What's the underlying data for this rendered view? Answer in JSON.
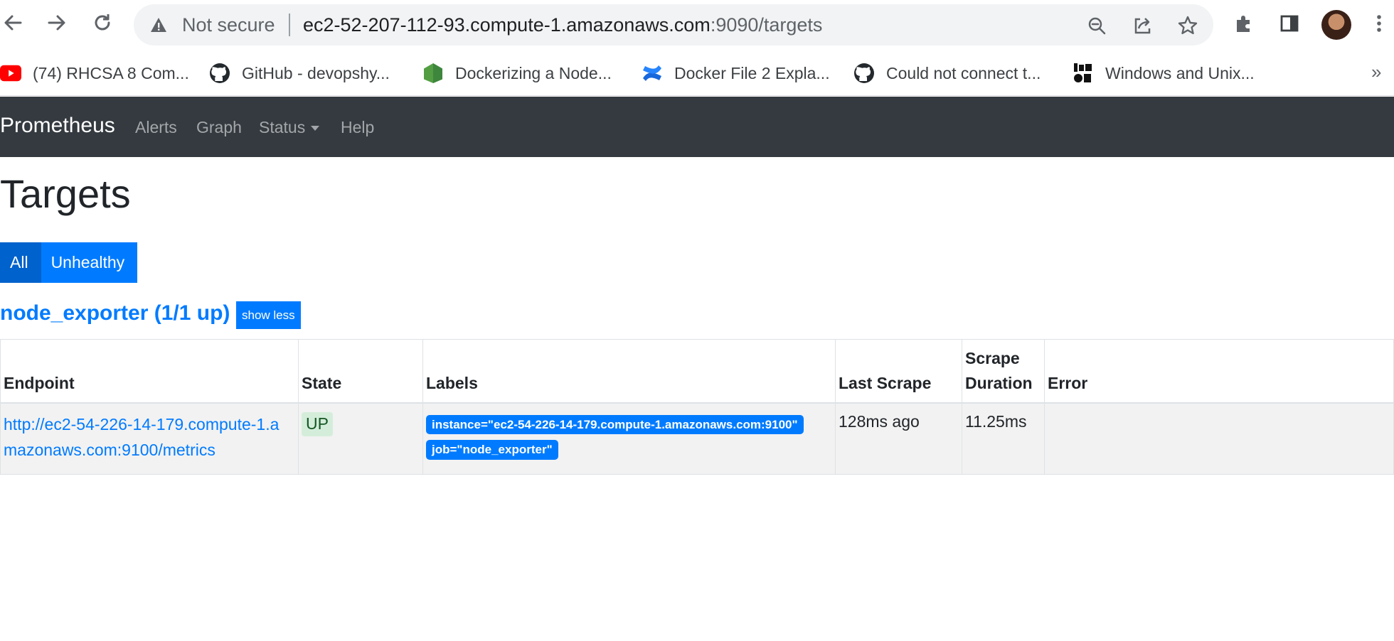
{
  "browser": {
    "security_label": "Not secure",
    "url_host": "ec2-52-207-112-93.compute-1.amazonaws.com",
    "url_rest": ":9090/targets",
    "bookmarks": [
      {
        "label": "(74) RHCSA 8 Com...",
        "icon": "youtube-icon"
      },
      {
        "label": "GitHub - devopshy...",
        "icon": "github-icon"
      },
      {
        "label": "Dockerizing a Node...",
        "icon": "nodejs-icon"
      },
      {
        "label": "Docker File 2 Expla...",
        "icon": "confluence-icon"
      },
      {
        "label": "Could not connect t...",
        "icon": "github-icon"
      },
      {
        "label": "Windows and Unix...",
        "icon": "lemoda-icon"
      }
    ],
    "more_bookmarks": "»"
  },
  "navbar": {
    "brand": "Prometheus",
    "links": [
      "Alerts",
      "Graph",
      "Status",
      "Help"
    ]
  },
  "page": {
    "title": "Targets",
    "filter_all": "All",
    "filter_unhealthy": "Unhealthy"
  },
  "job": {
    "title": "node_exporter (1/1 up)",
    "toggle": "show less",
    "columns": [
      "Endpoint",
      "State",
      "Labels",
      "Last Scrape",
      "Scrape Duration",
      "Error"
    ],
    "rows": [
      {
        "endpoint": "http://ec2-54-226-14-179.compute-1.amazonaws.com:9100/metrics",
        "state": "UP",
        "labels": [
          "instance=\"ec2-54-226-14-179.compute-1.amazonaws.com:9100\"",
          "job=\"node_exporter\""
        ],
        "last_scrape": "128ms ago",
        "scrape_duration": "11.25ms",
        "error": ""
      }
    ]
  },
  "colors": {
    "navbar_bg": "#343a40",
    "primary": "#007bff",
    "primary_active": "#0062cc",
    "up_badge_bg": "#d4edda",
    "up_badge_text": "#155724"
  }
}
